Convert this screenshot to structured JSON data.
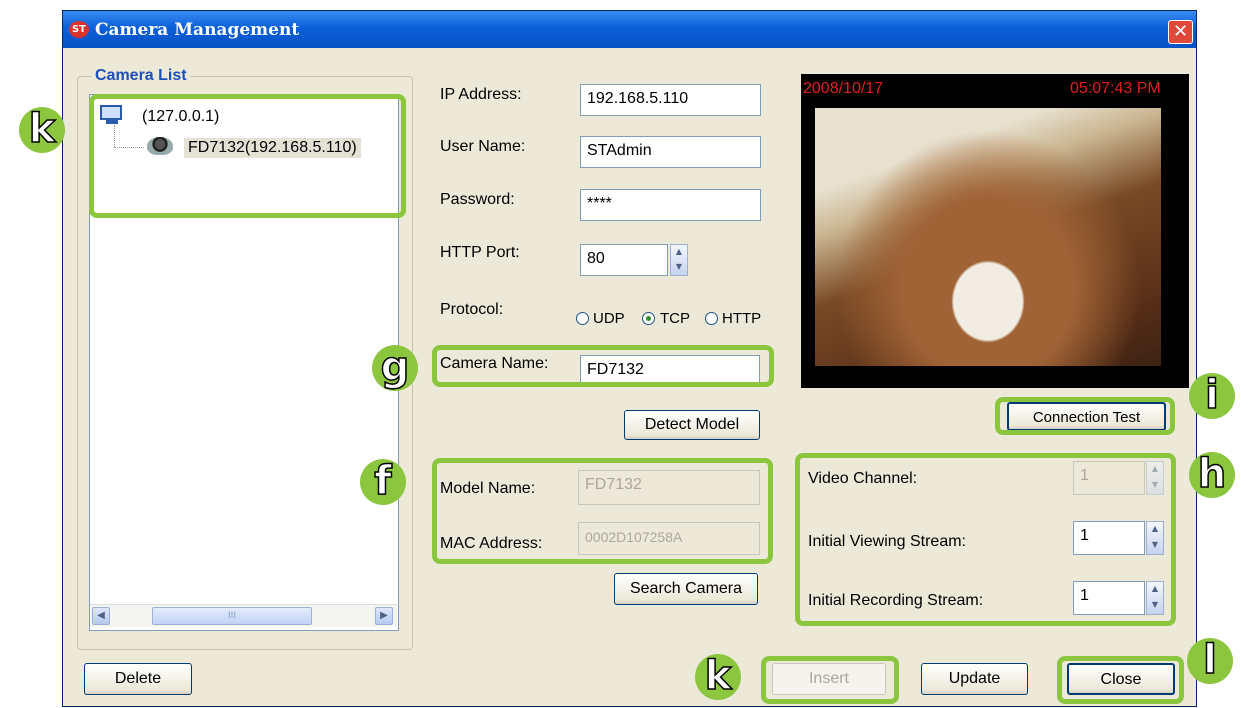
{
  "window": {
    "title": "Camera Management",
    "app_icon": "ST",
    "close_glyph": "✕"
  },
  "camera_list": {
    "title": "Camera List",
    "root_label": "(127.0.0.1)",
    "camera_label": "FD7132(192.168.5.110)",
    "scroll_thumb": "III"
  },
  "form": {
    "ip_label": "IP Address:",
    "ip_value": "192.168.5.110",
    "user_label": "User Name:",
    "user_value": "STAdmin",
    "password_label": "Password:",
    "password_value": "****",
    "port_label": "HTTP Port:",
    "port_value": "80",
    "protocol_label": "Protocol:",
    "protocols": [
      "UDP",
      "TCP",
      "HTTP"
    ],
    "protocol_selected": "TCP",
    "camera_name_label": "Camera Name:",
    "camera_name_value": "FD7132",
    "model_name_label": "Model Name:",
    "model_name_value": "FD7132",
    "mac_label": "MAC Address:",
    "mac_value": "0002D107258A",
    "video_channel_label": "Video Channel:",
    "video_channel_value": "1",
    "initial_viewing_label": "Initial Viewing Stream:",
    "initial_viewing_value": "1",
    "initial_recording_label": "Initial Recording Stream:",
    "initial_recording_value": "1"
  },
  "buttons": {
    "detect_model": "Detect Model",
    "search_camera": "Search Camera",
    "connection_test": "Connection Test",
    "delete": "Delete",
    "insert": "Insert",
    "update": "Update",
    "close": "Close"
  },
  "video": {
    "date": "2008/10/17",
    "time": "05:07:43 PM"
  },
  "callouts": {
    "k1": "k",
    "k2": "k",
    "g": "g",
    "f": "f",
    "i": "i",
    "h": "h",
    "l": "l"
  },
  "colors": {
    "highlight": "#8cc63f",
    "titlebar": "#0a5fd9",
    "timestamp": "#e02020"
  }
}
